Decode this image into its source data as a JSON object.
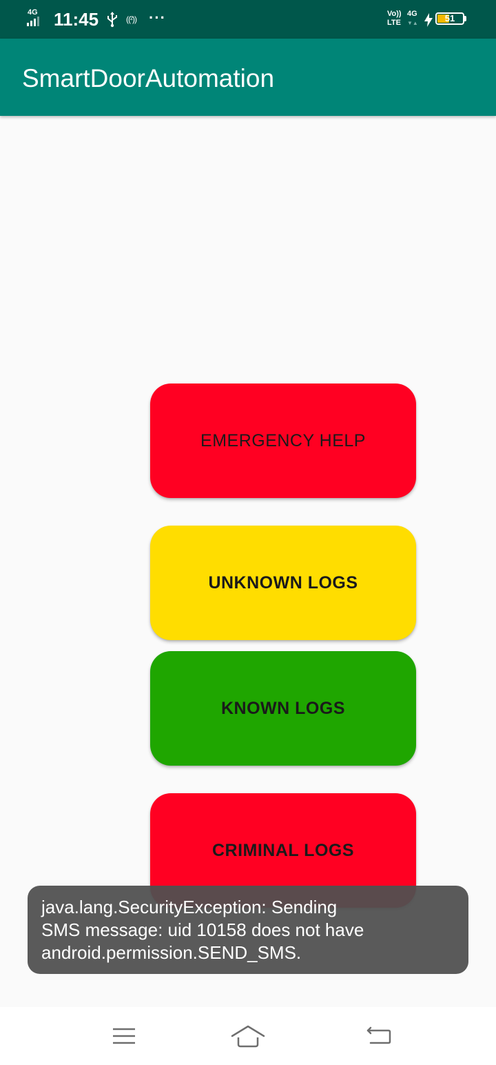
{
  "status_bar": {
    "network_type": "4G",
    "time": "11:45",
    "hotspot_label": "((²))",
    "more_indicator": "···",
    "volte_top": "Vo))",
    "volte_bottom": "LTE",
    "data_type": "4G",
    "data_arrows": "▼▲",
    "battery_level": "51",
    "battery_color": "#F5B800",
    "icons": [
      "signal-icon",
      "usb-icon",
      "hotspot-icon",
      "charging-bolt-icon",
      "battery-icon"
    ]
  },
  "app_bar": {
    "title": "SmartDoorAutomation",
    "color": "#008577"
  },
  "buttons": {
    "emergency_help": {
      "label": "EMERGENCY HELP",
      "color": "#FF0022"
    },
    "unknown_logs": {
      "label": "UNKNOWN LOGS",
      "color": "#FFDD00"
    },
    "known_logs": {
      "label": "KNOWN LOGS",
      "color": "#1FA600"
    },
    "criminal_logs": {
      "label": "CRIMINAL LOGS",
      "color": "#FF0022"
    }
  },
  "toast": {
    "lines": [
      "java.lang.SecurityException: Sending",
      "SMS message: uid 10158 does not have",
      "android.permission.SEND_SMS."
    ]
  },
  "nav_bar": {
    "icons": [
      "menu-icon",
      "home-icon",
      "back-icon"
    ]
  }
}
